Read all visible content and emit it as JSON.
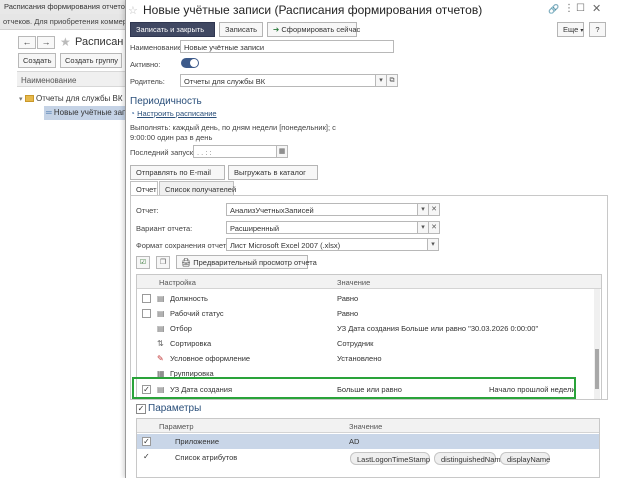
{
  "background_app": {
    "tab_title": "Расписания формирования отчетов",
    "notice": "отчеков. Для приобретения коммерческ",
    "back_glyph": "←",
    "forward_glyph": "→",
    "title": "Расписан",
    "create_label": "Создать",
    "create_group_label": "Создать группу",
    "column_name": "Наименование",
    "tree": [
      "Отчеты для службы ВК",
      "Новые учётные записи"
    ]
  },
  "dialog": {
    "title": "Новые учётные записи (Расписания формирования отчетов)",
    "toolbar": {
      "save_close": "Записать и закрыть",
      "save": "Записать",
      "generate_now": "Сформировать сейчас",
      "more": "Еще",
      "help": "?"
    },
    "form": {
      "name_label": "Наименование:",
      "name_value": "Новые учётные записи",
      "active_label": "Активно:",
      "parent_label": "Родитель:",
      "parent_value": "Отчеты для службы ВК"
    },
    "periodicity": {
      "title": "Периодичность",
      "link": "Настроить расписание",
      "description_line1": "Выполнять: каждый день, по дням недели [понедельник]; с",
      "description_line2": "9:00:00 один раз в день",
      "last_run_label": "Последний запуск:",
      "last_run_value": ". .    : :"
    },
    "actions": {
      "send_email": "Отправлять по E-mail",
      "upload_catalog": "Выгружать в каталог"
    },
    "tabs": [
      "Отчет",
      "Список получателей"
    ],
    "report": {
      "report_label": "Отчет:",
      "report_value": "АнализУчетныхЗаписей",
      "variant_label": "Вариант отчета:",
      "variant_value": "Расширенный",
      "format_label": "Формат сохранения отчета:",
      "format_value": "Лист Microsoft Excel 2007 (.xlsx)",
      "preview_label": "Предварительный просмотр отчета"
    },
    "settings_grid": {
      "col_setting": "Настройка",
      "col_value": "Значение",
      "rows": [
        {
          "name": "Должность",
          "value": "Равно",
          "extra": "",
          "check": "empty"
        },
        {
          "name": "Рабочий статус",
          "value": "Равно",
          "extra": "",
          "check": "empty"
        },
        {
          "name": "Отбор",
          "value": "УЗ Дата создания Больше или равно \"30.03.2026 0:00:00\"",
          "extra": "",
          "check": "none"
        },
        {
          "name": "Сортировка",
          "value": "Сотрудник",
          "extra": "",
          "check": "none"
        },
        {
          "name": "Условное оформление",
          "value": "Установлено",
          "extra": "",
          "check": "none"
        },
        {
          "name": "Группировка",
          "value": "",
          "extra": "",
          "check": "none"
        },
        {
          "name": "УЗ Дата создания",
          "value": "Больше или равно",
          "extra": "Начало прошлой недели",
          "check": "checked"
        }
      ]
    },
    "parameters": {
      "title": "Параметры",
      "col_param": "Параметр",
      "col_value": "Значение",
      "rows": [
        {
          "name": "Приложение",
          "value": "AD"
        },
        {
          "name": "Список атрибутов",
          "value": ""
        }
      ],
      "chips": [
        "LastLogonTimeStamp",
        "distinguishedName",
        "displayName"
      ]
    }
  },
  "colors": {
    "primary_button": "#404862",
    "accent_link": "#2a4f7a",
    "highlight_green": "#2aa33a",
    "toggle_on": "#3d5a8a"
  }
}
